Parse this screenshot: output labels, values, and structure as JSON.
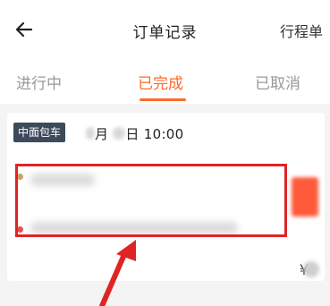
{
  "header": {
    "title": "订单记录",
    "itinerary_label": "行程单"
  },
  "tabs": [
    {
      "label": "进行中",
      "active": false
    },
    {
      "label": "已完成",
      "active": true
    },
    {
      "label": "已取消",
      "active": false
    }
  ],
  "order": {
    "type_badge": "中面包车",
    "time_month_suffix": "月",
    "time_day_suffix": "日 10:00",
    "currency_symbol": "¥"
  },
  "colors": {
    "accent": "#ff6a2b",
    "badge_bg": "#3d4a5c",
    "highlight_box": "#e02424"
  },
  "icons": {
    "back": "arrow-left-icon"
  }
}
